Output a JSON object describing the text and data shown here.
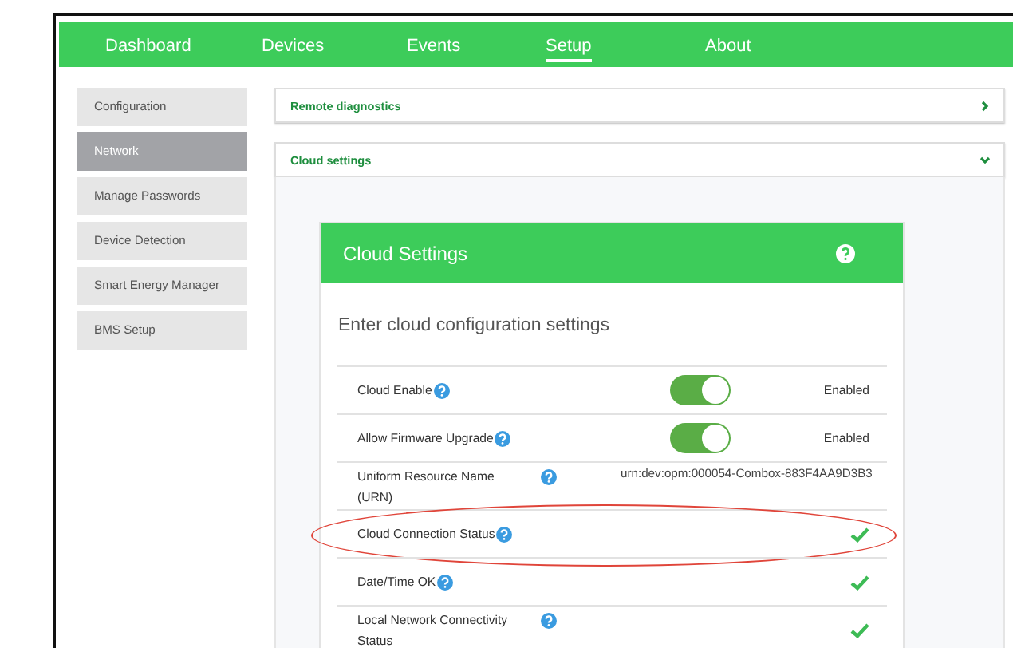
{
  "nav": [
    {
      "label": "Dashboard",
      "selected": false
    },
    {
      "label": "Devices",
      "selected": false
    },
    {
      "label": "Events",
      "selected": false
    },
    {
      "label": "Setup",
      "selected": true
    },
    {
      "label": "About",
      "selected": false
    }
  ],
  "sidebar": {
    "items": [
      {
        "label": "Configuration",
        "selected": false
      },
      {
        "label": "Network",
        "selected": true
      },
      {
        "label": "Manage Passwords",
        "selected": false
      },
      {
        "label": "Device Detection",
        "selected": false
      },
      {
        "label": "Smart Energy Manager",
        "selected": false
      },
      {
        "label": "BMS Setup",
        "selected": false
      }
    ]
  },
  "sections": [
    {
      "title": "Remote diagnostics",
      "expanded": false
    },
    {
      "title": "Cloud settings",
      "expanded": true
    }
  ],
  "card": {
    "title": "Cloud Settings",
    "subtitle": "Enter cloud configuration settings",
    "rows": [
      {
        "kind": "toggle",
        "label": "Cloud Enable",
        "on": true,
        "status": "Enabled",
        "highlighted": false
      },
      {
        "kind": "toggle",
        "label": "Allow Firmware Upgrade",
        "on": true,
        "status": "Enabled",
        "highlighted": false
      },
      {
        "kind": "text",
        "label": "Uniform Resource Name (URN)",
        "value": "urn:dev:opm:000054-Combox-883F4AA9D3B3",
        "highlighted": false
      },
      {
        "kind": "check",
        "label": "Cloud Connection Status",
        "ok": true,
        "highlighted": true
      },
      {
        "kind": "check",
        "label": "Date/Time OK",
        "ok": true,
        "highlighted": false
      },
      {
        "kind": "check",
        "label": "Local Network Connectivity Status",
        "ok": true,
        "highlighted": false
      }
    ]
  }
}
